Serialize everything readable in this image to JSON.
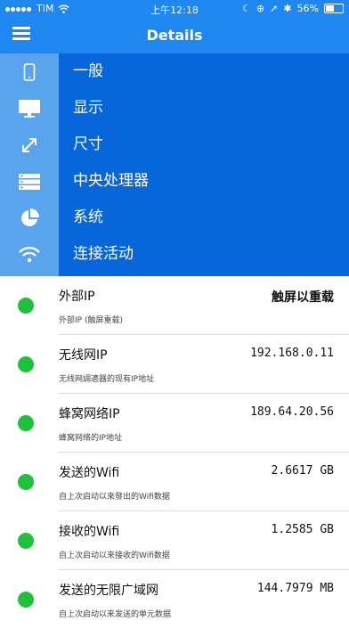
{
  "status": {
    "carrier": "TIM",
    "time": "上午12:18",
    "battery": "56%",
    "battery_level": 0.56
  },
  "nav": {
    "title": "Details"
  },
  "menu": {
    "items": [
      {
        "label": "一般",
        "icon": "phone-icon"
      },
      {
        "label": "显示",
        "icon": "monitor-icon"
      },
      {
        "label": "尺寸",
        "icon": "resize-arrows-icon"
      },
      {
        "label": "中央处理器",
        "icon": "server-icon"
      },
      {
        "label": "系统",
        "icon": "pie-chart-icon"
      },
      {
        "label": "连接活动",
        "icon": "wifi-icon"
      }
    ]
  },
  "rows": [
    {
      "name": "外部IP",
      "value": "触屏以重载",
      "desc": "外部IP (触屏重载)"
    },
    {
      "name": "无线网IP",
      "value": "192.168.0.11",
      "desc": "无线网調適器的现有IP地址"
    },
    {
      "name": "蜂窝网络IP",
      "value": "189.64.20.56",
      "desc": "蜂窝网络的IP地址"
    },
    {
      "name": "发送的Wifi",
      "value": "2.6617 GB",
      "desc": "自上次启动以來發出的Wifi数据"
    },
    {
      "name": "接收的Wifi",
      "value": "1.2585 GB",
      "desc": "自上次启动以来接收的Wifi数据"
    },
    {
      "name": "发送的无限广域网",
      "value": "144.7979 MB",
      "desc": "自上次启动以来发送的单元数据"
    }
  ],
  "colors": {
    "nav": "#1f87f0",
    "menu_bg": "#0766d9",
    "icon_col": "#5aa4ee",
    "status_dot": "#1fc03c"
  }
}
